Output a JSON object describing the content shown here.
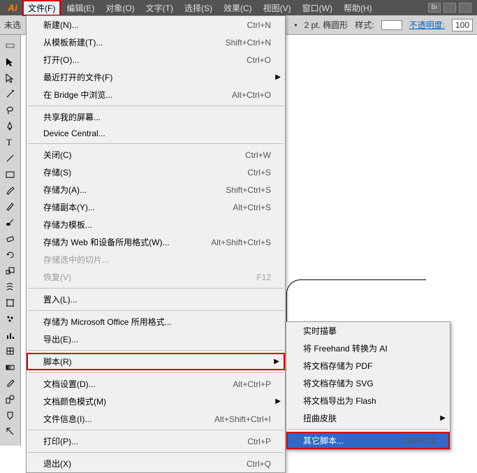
{
  "logo": "Ai",
  "menubar": [
    "文件(F)",
    "编辑(E)",
    "对象(O)",
    "文字(T)",
    "选择(S)",
    "效果(C)",
    "视图(V)",
    "窗口(W)",
    "帮助(H)"
  ],
  "options": {
    "doc_label": "未选",
    "stroke": "2 pt. 椭圆形",
    "style_label": "样式:",
    "opacity_label": "不透明度:",
    "opacity_value": "100"
  },
  "file_menu": [
    {
      "label": "新建(N)...",
      "shortcut": "Ctrl+N"
    },
    {
      "label": "从模板新建(T)...",
      "shortcut": "Shift+Ctrl+N"
    },
    {
      "label": "打开(O)...",
      "shortcut": "Ctrl+O"
    },
    {
      "label": "最近打开的文件(F)",
      "arrow": true
    },
    {
      "label": "在 Bridge 中浏览...",
      "shortcut": "Alt+Ctrl+O"
    },
    {
      "sep": true
    },
    {
      "label": "共享我的屏幕..."
    },
    {
      "label": "Device Central..."
    },
    {
      "sep": true
    },
    {
      "label": "关闭(C)",
      "shortcut": "Ctrl+W"
    },
    {
      "label": "存储(S)",
      "shortcut": "Ctrl+S"
    },
    {
      "label": "存储为(A)...",
      "shortcut": "Shift+Ctrl+S"
    },
    {
      "label": "存储副本(Y)...",
      "shortcut": "Alt+Ctrl+S"
    },
    {
      "label": "存储为模板..."
    },
    {
      "label": "存储为 Web 和设备所用格式(W)...",
      "shortcut": "Alt+Shift+Ctrl+S"
    },
    {
      "label": "存储选中的切片...",
      "disabled": true
    },
    {
      "label": "恢复(V)",
      "shortcut": "F12",
      "disabled": true
    },
    {
      "sep": true
    },
    {
      "label": "置入(L)..."
    },
    {
      "sep": true
    },
    {
      "label": "存储为 Microsoft Office 所用格式..."
    },
    {
      "label": "导出(E)..."
    },
    {
      "sep": true
    },
    {
      "label": "脚本(R)",
      "arrow": true,
      "highlight": true
    },
    {
      "sep": true
    },
    {
      "label": "文档设置(D)...",
      "shortcut": "Alt+Ctrl+P"
    },
    {
      "label": "文档颜色模式(M)",
      "arrow": true
    },
    {
      "label": "文件信息(I)...",
      "shortcut": "Alt+Shift+Ctrl+I"
    },
    {
      "sep": true
    },
    {
      "label": "打印(P)...",
      "shortcut": "Ctrl+P"
    },
    {
      "sep": true
    },
    {
      "label": "退出(X)",
      "shortcut": "Ctrl+Q"
    }
  ],
  "script_submenu": [
    {
      "label": "实时描摹"
    },
    {
      "label": "将 Freehand 转换为 AI"
    },
    {
      "label": "将文档存储为 PDF"
    },
    {
      "label": "将文档存储为 SVG"
    },
    {
      "label": "将文档导出为 Flash"
    },
    {
      "label": "扭曲皮肤",
      "arrow": true
    },
    {
      "sep": true
    },
    {
      "label": "其它脚本...",
      "shortcut": "Ctrl+F12",
      "highlight": true
    }
  ]
}
